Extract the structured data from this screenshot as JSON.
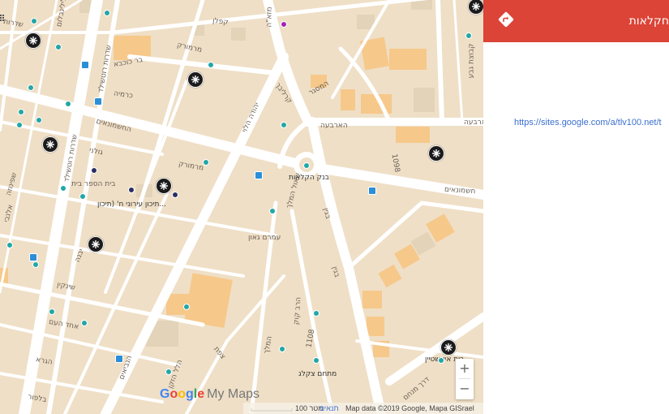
{
  "map": {
    "streets": [
      {
        "id": "lilienblum",
        "label": "לילינבלום"
      },
      {
        "id": "rothschild",
        "label": "שדרות רוטשילד"
      },
      {
        "id": "rothschild2",
        "label": "שדרות רוטשילד"
      },
      {
        "id": "mazeh",
        "label": "מזא\"ה"
      },
      {
        "id": "marmorek",
        "label": "מרמורק"
      },
      {
        "id": "yehuda-halevi",
        "label": "יהודה הלוי"
      },
      {
        "id": "carlebach",
        "label": "קרליבך"
      },
      {
        "id": "begin",
        "label": "בגין"
      },
      {
        "id": "begin2",
        "label": "בגין"
      },
      {
        "id": "hashmonaim",
        "label": "החשמונאים"
      },
      {
        "id": "hashmonaim2",
        "label": "חשמונאים"
      },
      {
        "id": "harbaa",
        "label": "הארבעה"
      },
      {
        "id": "harbaa2",
        "label": "הארבעה"
      },
      {
        "id": "karmia",
        "label": "כרמיה"
      },
      {
        "id": "berkovich",
        "label": "בר כוכבא"
      },
      {
        "id": "hamasger",
        "label": "המסגר"
      },
      {
        "id": "ehad-haam",
        "label": "אחד העם"
      },
      {
        "id": "hanavim",
        "label": "הנביאים"
      },
      {
        "id": "shenkin",
        "label": "שינקין"
      },
      {
        "id": "yavne",
        "label": "יבנה"
      },
      {
        "id": "hagra",
        "label": "הגרא"
      },
      {
        "id": "balfour",
        "label": "בלפור"
      },
      {
        "id": "tsfat",
        "label": "צפת"
      },
      {
        "id": "hamelech",
        "label": "המלך"
      },
      {
        "id": "derech-menachem",
        "label": "דרך מנחם"
      },
      {
        "id": "street-1098",
        "label": "1098"
      },
      {
        "id": "street-1108",
        "label": "1108"
      },
      {
        "id": "rehov-3",
        "label": "שדרות"
      },
      {
        "id": "rehov-4",
        "label": "קפלן"
      },
      {
        "id": "rehov-5",
        "label": "קבוצת גבע"
      },
      {
        "id": "rehov-6",
        "label": "בית הספר בית"
      },
      {
        "id": "rehov-7",
        "label": "גולני"
      },
      {
        "id": "rehov-8",
        "label": "שפינוזה"
      },
      {
        "id": "rehov-9",
        "label": "שאול המלך"
      },
      {
        "id": "rehov-10",
        "label": "עמרם גאון"
      },
      {
        "id": "rehov-11",
        "label": "מרמורק"
      },
      {
        "id": "rehov-12",
        "label": "הלל הזקן"
      },
      {
        "id": "rehov-13",
        "label": "אלנבי"
      },
      {
        "id": "rehov-14",
        "label": "הרב קוק"
      }
    ],
    "pois": [
      {
        "id": "bank",
        "label": "בנק הקלאות"
      },
      {
        "id": "school",
        "label": "תיכון עירוני ח' (תיכון..."
      },
      {
        "id": "matcham",
        "label": "מתחם צקלג"
      },
      {
        "id": "einstein",
        "label": "בית איינשטיין"
      }
    ],
    "brand": {
      "g1": "G",
      "o1": "o",
      "o2": "o",
      "g2": "g",
      "l": "l",
      "e": "e",
      "my_maps": "My Maps"
    },
    "footer": {
      "scale": "100 מטר",
      "terms": "תנאים",
      "data": "Map data ©2019 Google, Mapa GISrael"
    },
    "zoom": {
      "in": "+",
      "out": "−"
    },
    "colors": {
      "land": "#efdfc6",
      "road": "#ffffff",
      "building": "#f6c88a",
      "park": "#e6d7bd",
      "marker": "#1b1b1b",
      "dot": "#23a6a6",
      "transit": "#2b8fd8"
    }
  },
  "panel": {
    "title": "חקלאות",
    "link": "https://sites.google.com/a/tlv100.net/t",
    "header_color": "#db4437",
    "directions_icon": "directions-icon"
  }
}
